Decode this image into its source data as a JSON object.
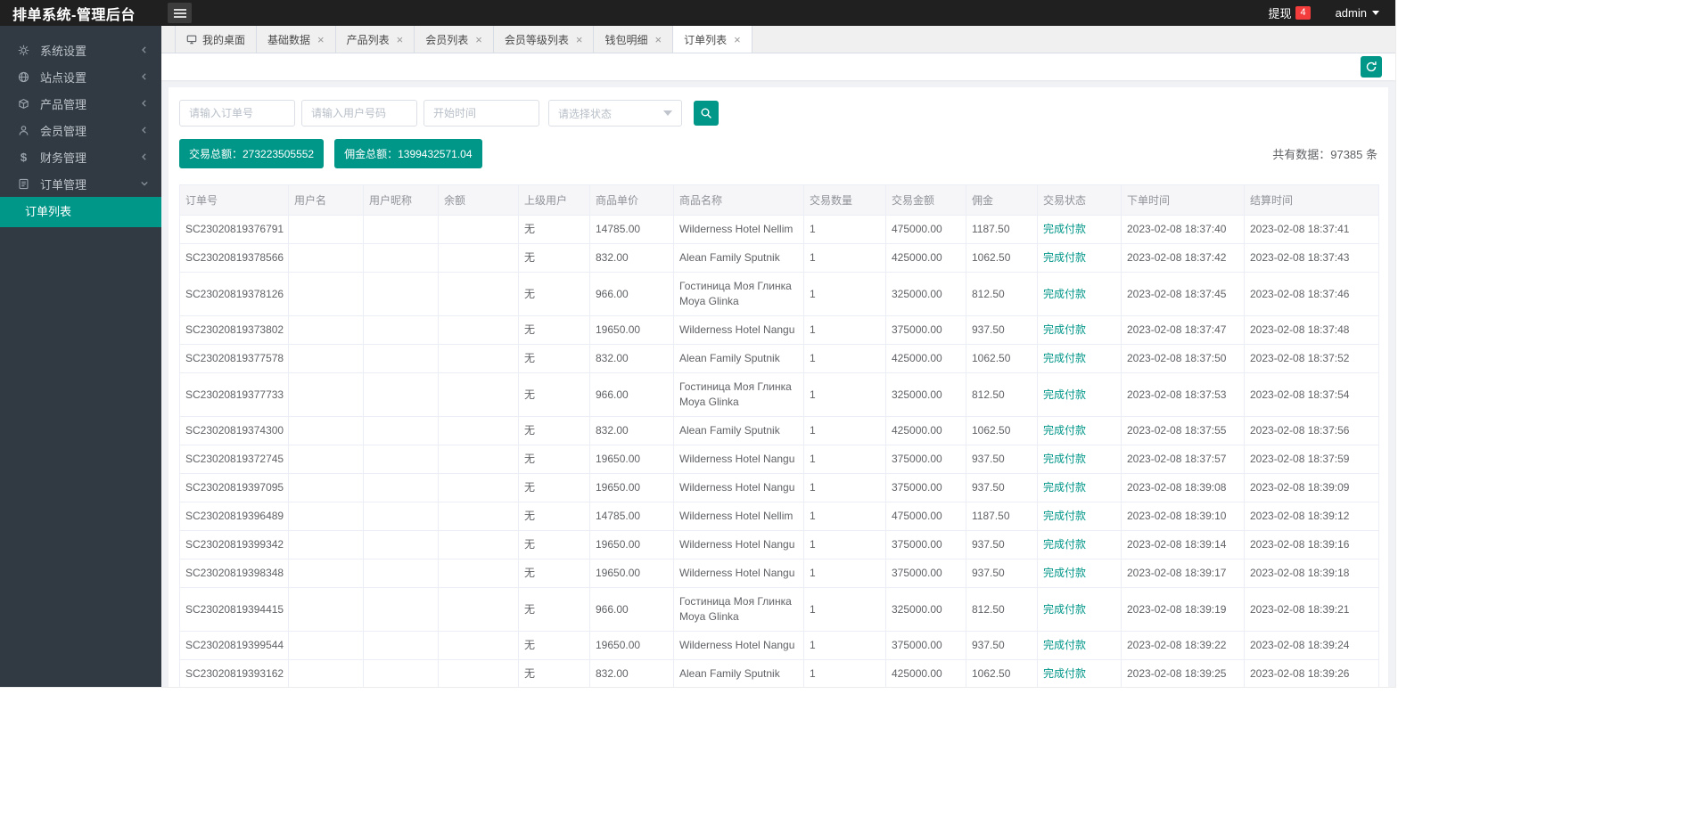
{
  "header": {
    "title": "排单系统-管理后台",
    "withdraw_label": "提现",
    "withdraw_count": "4",
    "user": "admin"
  },
  "sidebar": {
    "items": [
      {
        "icon": "gear-icon",
        "label": "系统设置",
        "state": "collapsed"
      },
      {
        "icon": "site-icon",
        "label": "站点设置",
        "state": "collapsed"
      },
      {
        "icon": "product-icon",
        "label": "产品管理",
        "state": "collapsed"
      },
      {
        "icon": "member-icon",
        "label": "会员管理",
        "state": "collapsed"
      },
      {
        "icon": "finance-icon",
        "label": "财务管理",
        "state": "collapsed"
      },
      {
        "icon": "order-icon",
        "label": "订单管理",
        "state": "expanded",
        "children": [
          {
            "label": "订单列表",
            "active": true
          }
        ]
      }
    ]
  },
  "tabs": [
    {
      "label": "我的桌面",
      "icon": "home-icon",
      "closable": false,
      "active": false
    },
    {
      "label": "基础数据",
      "closable": true,
      "active": false
    },
    {
      "label": "产品列表",
      "closable": true,
      "active": false
    },
    {
      "label": "会员列表",
      "closable": true,
      "active": false
    },
    {
      "label": "会员等级列表",
      "closable": true,
      "active": false
    },
    {
      "label": "钱包明细",
      "closable": true,
      "active": false
    },
    {
      "label": "订单列表",
      "closable": true,
      "active": true
    }
  ],
  "search": {
    "order_placeholder": "请输入订单号",
    "user_placeholder": "请输入用户号码",
    "time_placeholder": "开始时间",
    "status_placeholder": "请选择状态"
  },
  "summary": {
    "total_amount_label": "交易总额：273223505552",
    "total_commission_label": "佣金总额：1399432571.04",
    "total_count": "共有数据：97385 条"
  },
  "table": {
    "columns": [
      "订单号",
      "用户名",
      "用户昵称",
      "余额",
      "上级用户",
      "商品单价",
      "商品名称",
      "交易数量",
      "交易金额",
      "佣金",
      "交易状态",
      "下单时间",
      "结算时间"
    ],
    "rows": [
      [
        "SC23020819376791",
        "",
        "",
        "",
        "无",
        "14785.00",
        "Wilderness Hotel Nellim",
        "1",
        "475000.00",
        "1187.50",
        "完成付款",
        "2023-02-08 18:37:40",
        "2023-02-08 18:37:41"
      ],
      [
        "SC23020819378566",
        "",
        "",
        "",
        "无",
        "832.00",
        "Alean Family Sputnik",
        "1",
        "425000.00",
        "1062.50",
        "完成付款",
        "2023-02-08 18:37:42",
        "2023-02-08 18:37:43"
      ],
      [
        "SC23020819378126",
        "",
        "",
        "",
        "无",
        "966.00",
        "Гостиница Моя Глинка Moya Glinka",
        "1",
        "325000.00",
        "812.50",
        "完成付款",
        "2023-02-08 18:37:45",
        "2023-02-08 18:37:46"
      ],
      [
        "SC23020819373802",
        "",
        "",
        "",
        "无",
        "19650.00",
        "Wilderness Hotel Nangu",
        "1",
        "375000.00",
        "937.50",
        "完成付款",
        "2023-02-08 18:37:47",
        "2023-02-08 18:37:48"
      ],
      [
        "SC23020819377578",
        "",
        "",
        "",
        "无",
        "832.00",
        "Alean Family Sputnik",
        "1",
        "425000.00",
        "1062.50",
        "完成付款",
        "2023-02-08 18:37:50",
        "2023-02-08 18:37:52"
      ],
      [
        "SC23020819377733",
        "",
        "",
        "",
        "无",
        "966.00",
        "Гостиница Моя Глинка Moya Glinka",
        "1",
        "325000.00",
        "812.50",
        "完成付款",
        "2023-02-08 18:37:53",
        "2023-02-08 18:37:54"
      ],
      [
        "SC23020819374300",
        "",
        "",
        "",
        "无",
        "832.00",
        "Alean Family Sputnik",
        "1",
        "425000.00",
        "1062.50",
        "完成付款",
        "2023-02-08 18:37:55",
        "2023-02-08 18:37:56"
      ],
      [
        "SC23020819372745",
        "",
        "",
        "",
        "无",
        "19650.00",
        "Wilderness Hotel Nangu",
        "1",
        "375000.00",
        "937.50",
        "完成付款",
        "2023-02-08 18:37:57",
        "2023-02-08 18:37:59"
      ],
      [
        "SC23020819397095",
        "",
        "",
        "",
        "无",
        "19650.00",
        "Wilderness Hotel Nangu",
        "1",
        "375000.00",
        "937.50",
        "完成付款",
        "2023-02-08 18:39:08",
        "2023-02-08 18:39:09"
      ],
      [
        "SC23020819396489",
        "",
        "",
        "",
        "无",
        "14785.00",
        "Wilderness Hotel Nellim",
        "1",
        "475000.00",
        "1187.50",
        "完成付款",
        "2023-02-08 18:39:10",
        "2023-02-08 18:39:12"
      ],
      [
        "SC23020819399342",
        "",
        "",
        "",
        "无",
        "19650.00",
        "Wilderness Hotel Nangu",
        "1",
        "375000.00",
        "937.50",
        "完成付款",
        "2023-02-08 18:39:14",
        "2023-02-08 18:39:16"
      ],
      [
        "SC23020819398348",
        "",
        "",
        "",
        "无",
        "19650.00",
        "Wilderness Hotel Nangu",
        "1",
        "375000.00",
        "937.50",
        "完成付款",
        "2023-02-08 18:39:17",
        "2023-02-08 18:39:18"
      ],
      [
        "SC23020819394415",
        "",
        "",
        "",
        "无",
        "966.00",
        "Гостиница Моя Глинка Moya Glinka",
        "1",
        "325000.00",
        "812.50",
        "完成付款",
        "2023-02-08 18:39:19",
        "2023-02-08 18:39:21"
      ],
      [
        "SC23020819399544",
        "",
        "",
        "",
        "无",
        "19650.00",
        "Wilderness Hotel Nangu",
        "1",
        "375000.00",
        "937.50",
        "完成付款",
        "2023-02-08 18:39:22",
        "2023-02-08 18:39:24"
      ],
      [
        "SC23020819393162",
        "",
        "",
        "",
        "无",
        "832.00",
        "Alean Family Sputnik",
        "1",
        "425000.00",
        "1062.50",
        "完成付款",
        "2023-02-08 18:39:25",
        "2023-02-08 18:39:26"
      ]
    ],
    "status_column_index": 10
  },
  "colors": {
    "accent": "#009688",
    "danger": "#f33d3d",
    "header_bg": "#202020",
    "sidebar_bg": "#313a43"
  }
}
